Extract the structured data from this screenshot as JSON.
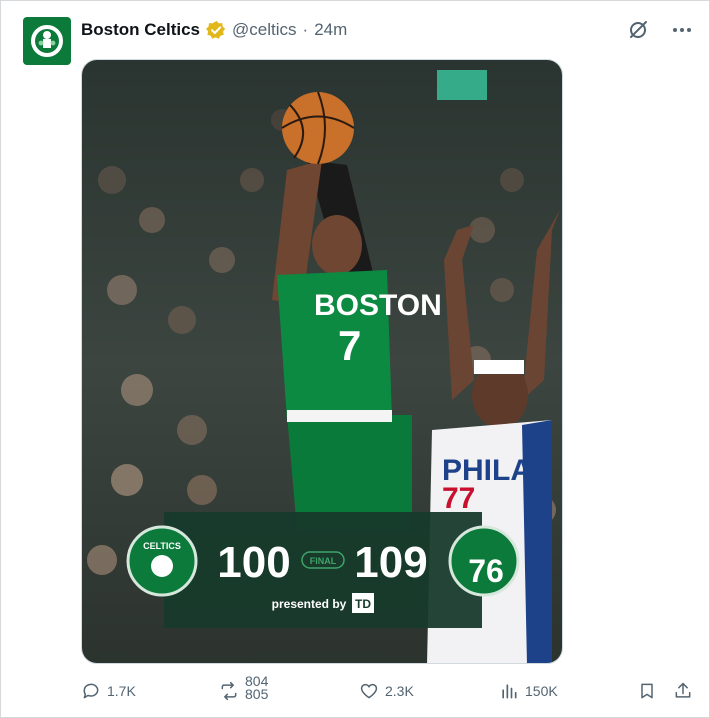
{
  "tweet": {
    "author_name": "Boston Celtics",
    "handle": "@celtics",
    "separator": "·",
    "time": "24m",
    "verified": true
  },
  "media": {
    "scoreboard": {
      "home_score": "100",
      "away_score": "109",
      "status": "FINAL",
      "sponsor_text": "presented by",
      "sponsor_logo": "TD",
      "home_team_logo_text": "CELTICS",
      "away_team_logo_text": "76"
    },
    "player": {
      "jersey_text": "BOSTON",
      "jersey_number": "7"
    },
    "defender": {
      "jersey_text": "PHILA",
      "jersey_number": "77"
    }
  },
  "actions": {
    "replies": "1.7K",
    "reposts_line1": "804",
    "reposts_line2": "805",
    "likes": "2.3K",
    "views": "150K"
  },
  "icons": {
    "reply": "reply-icon",
    "repost": "repost-icon",
    "like": "heart-icon",
    "views": "views-chart-icon",
    "bookmark": "bookmark-icon",
    "share": "share-icon",
    "grok": "grok-icon",
    "more": "more-icon"
  },
  "colors": {
    "celtics_green": "#0b7a3b",
    "verified_gold": "#e2b719",
    "muted": "#536471",
    "sixers_blue": "#1d428a",
    "sixers_red": "#c8102e"
  }
}
